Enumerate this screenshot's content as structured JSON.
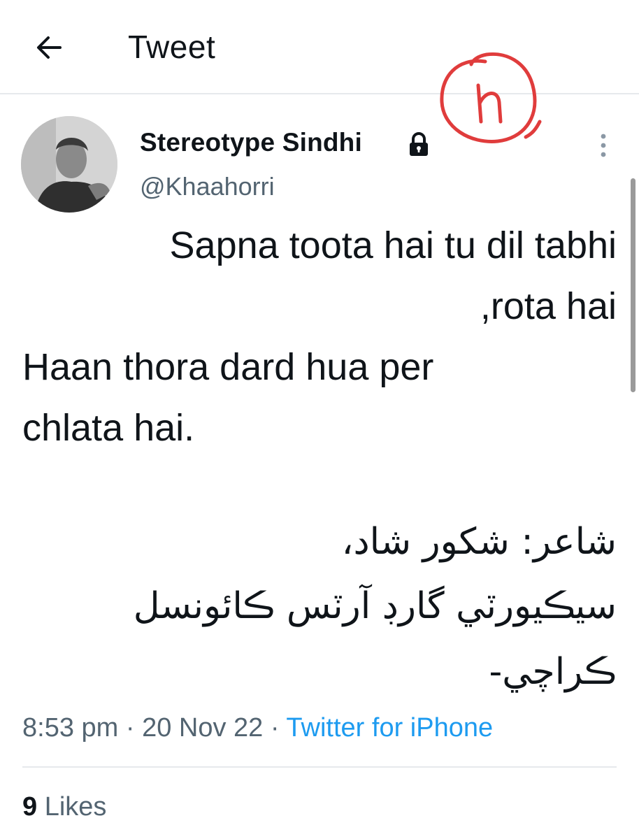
{
  "header": {
    "title": "Tweet",
    "back_icon": "arrow-left-icon"
  },
  "tweet": {
    "author": {
      "name": "Stereotype Sindhi",
      "handle": "@Khaahorri",
      "protected_icon": "lock-icon"
    },
    "more_icon": "vertical-ellipsis-icon",
    "text_lines": [
      "Sapna toota hai tu dil tabhi",
      ",rota hai",
      "Haan thora dard hua per",
      "chlata hai."
    ],
    "rtl_lines": [
      "شاعر: شکور شاد،",
      "سيڪيورٽي گارڊ آرٽس ڪائونسل",
      "ڪراچي-"
    ],
    "time": "8:53 pm",
    "separator": "·",
    "date": "20 Nov 22",
    "source": "Twitter for iPhone"
  },
  "stats": {
    "likes_count": "9",
    "likes_label": "Likes"
  },
  "colors": {
    "text": "#0f1419",
    "secondary": "#536471",
    "link": "#1d9bf0",
    "annotation": "#e03c3c"
  }
}
